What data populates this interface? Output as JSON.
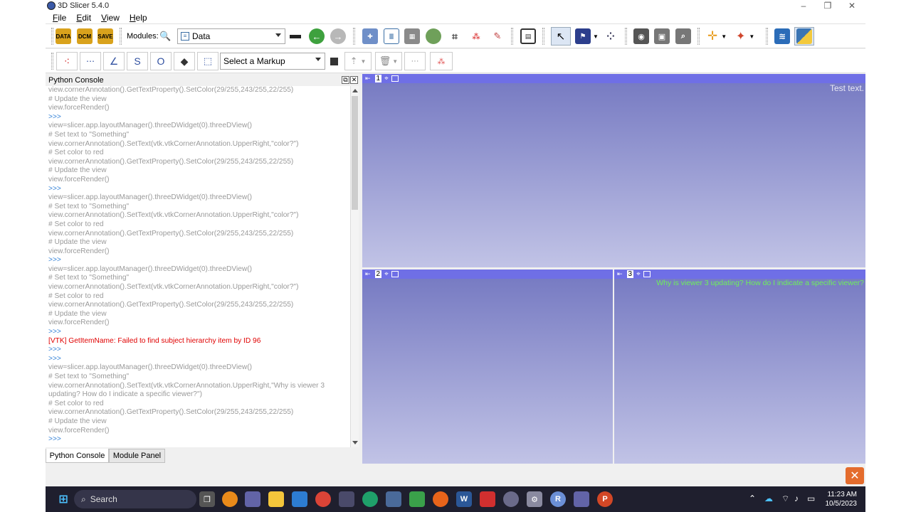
{
  "window": {
    "title": "3D Slicer 5.4.0",
    "minimize": "–",
    "restore": "❐",
    "close": "✕"
  },
  "menu": {
    "items": [
      "File",
      "Edit",
      "View",
      "Help"
    ]
  },
  "toolbar": {
    "data_label": "DATA",
    "dcm_label": "DCM",
    "save_label": "SAVE",
    "modules_label": "Modules:",
    "module_selected": "Data",
    "markup_selected": "Select a Markup"
  },
  "console": {
    "title": "Python Console",
    "lines": [
      {
        "t": "view.cornerAnnotation().GetTextProperty().SetColor(29/255,243/255,22/255)",
        "k": "code"
      },
      {
        "t": "# Update the view",
        "k": "comment"
      },
      {
        "t": "view.forceRender()",
        "k": "code"
      },
      {
        "t": ">>>",
        "k": "prompt"
      },
      {
        "t": "view=slicer.app.layoutManager().threeDWidget(0).threeDView()",
        "k": "code"
      },
      {
        "t": "# Set text to \"Something\"",
        "k": "comment"
      },
      {
        "t": "view.cornerAnnotation().SetText(vtk.vtkCornerAnnotation.UpperRight,\"color?\")",
        "k": "code"
      },
      {
        "t": "# Set color to red",
        "k": "comment"
      },
      {
        "t": "view.cornerAnnotation().GetTextProperty().SetColor(29/255,243/255,22/255)",
        "k": "code"
      },
      {
        "t": "# Update the view",
        "k": "comment"
      },
      {
        "t": "view.forceRender()",
        "k": "code"
      },
      {
        "t": ">>>",
        "k": "prompt"
      },
      {
        "t": "view=slicer.app.layoutManager().threeDWidget(0).threeDView()",
        "k": "code"
      },
      {
        "t": "# Set text to \"Something\"",
        "k": "comment"
      },
      {
        "t": "view.cornerAnnotation().SetText(vtk.vtkCornerAnnotation.UpperRight,\"color?\")",
        "k": "code"
      },
      {
        "t": "# Set color to red",
        "k": "comment"
      },
      {
        "t": "view.cornerAnnotation().GetTextProperty().SetColor(29/255,243/255,22/255)",
        "k": "code"
      },
      {
        "t": "# Update the view",
        "k": "comment"
      },
      {
        "t": "view.forceRender()",
        "k": "code"
      },
      {
        "t": ">>>",
        "k": "prompt"
      },
      {
        "t": "view=slicer.app.layoutManager().threeDWidget(0).threeDView()",
        "k": "code"
      },
      {
        "t": "# Set text to \"Something\"",
        "k": "comment"
      },
      {
        "t": "view.cornerAnnotation().SetText(vtk.vtkCornerAnnotation.UpperRight,\"color?\")",
        "k": "code"
      },
      {
        "t": "# Set color to red",
        "k": "comment"
      },
      {
        "t": "view.cornerAnnotation().GetTextProperty().SetColor(29/255,243/255,22/255)",
        "k": "code"
      },
      {
        "t": "# Update the view",
        "k": "comment"
      },
      {
        "t": "view.forceRender()",
        "k": "code"
      },
      {
        "t": ">>>",
        "k": "prompt"
      },
      {
        "t": "[VTK] GetItemName: Failed to find subject hierarchy item by ID 96",
        "k": "error"
      },
      {
        "t": ">>>",
        "k": "prompt"
      },
      {
        "t": ">>>",
        "k": "prompt"
      },
      {
        "t": "view=slicer.app.layoutManager().threeDWidget(0).threeDView()",
        "k": "code"
      },
      {
        "t": "# Set text to \"Something\"",
        "k": "comment"
      },
      {
        "t": "view.cornerAnnotation().SetText(vtk.vtkCornerAnnotation.UpperRight,\"Why is viewer 3",
        "k": "code"
      },
      {
        "t": "updating? How do I indicate a specific viewer?\")",
        "k": "code"
      },
      {
        "t": "# Set color to red",
        "k": "comment"
      },
      {
        "t": "view.cornerAnnotation().GetTextProperty().SetColor(29/255,243/255,22/255)",
        "k": "code"
      },
      {
        "t": "# Update the view",
        "k": "comment"
      },
      {
        "t": "view.forceRender()",
        "k": "code"
      },
      {
        "t": ">>>",
        "k": "prompt"
      }
    ]
  },
  "tabs": [
    "Python Console",
    "Module Panel"
  ],
  "views": {
    "v1": {
      "num": "1",
      "annotation": "Test text."
    },
    "v2": {
      "num": "2",
      "annotation": ""
    },
    "v3": {
      "num": "3",
      "annotation": "Why is viewer 3 updating? How do I indicate a specific viewer?"
    }
  },
  "colors": {
    "annotation_white": "#e8e8f4",
    "annotation_green": "#6ef05a",
    "view_bar": "#6f6fe6",
    "error": "#e00000",
    "prompt": "#2f7fd6"
  },
  "taskbar": {
    "search_placeholder": "Search",
    "time": "11:23 AM",
    "date": "10/5/2023"
  }
}
